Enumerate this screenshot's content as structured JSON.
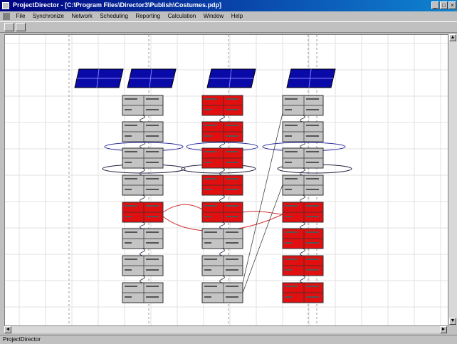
{
  "window": {
    "title": "ProjectDirector - [C:\\Program Files\\Director3\\Publish\\Costumes.pdp]"
  },
  "menu": [
    "File",
    "Synchronize",
    "Network",
    "Scheduling",
    "Reporting",
    "Calculation",
    "Window",
    "Help"
  ],
  "colors": {
    "header": "#0a0aa8",
    "task_gray": "#c4c4c4",
    "task_red": "#e01010",
    "link_red": "#d03030",
    "link_dark": "#202040"
  },
  "status": {
    "text": "ProjectDirector"
  }
}
